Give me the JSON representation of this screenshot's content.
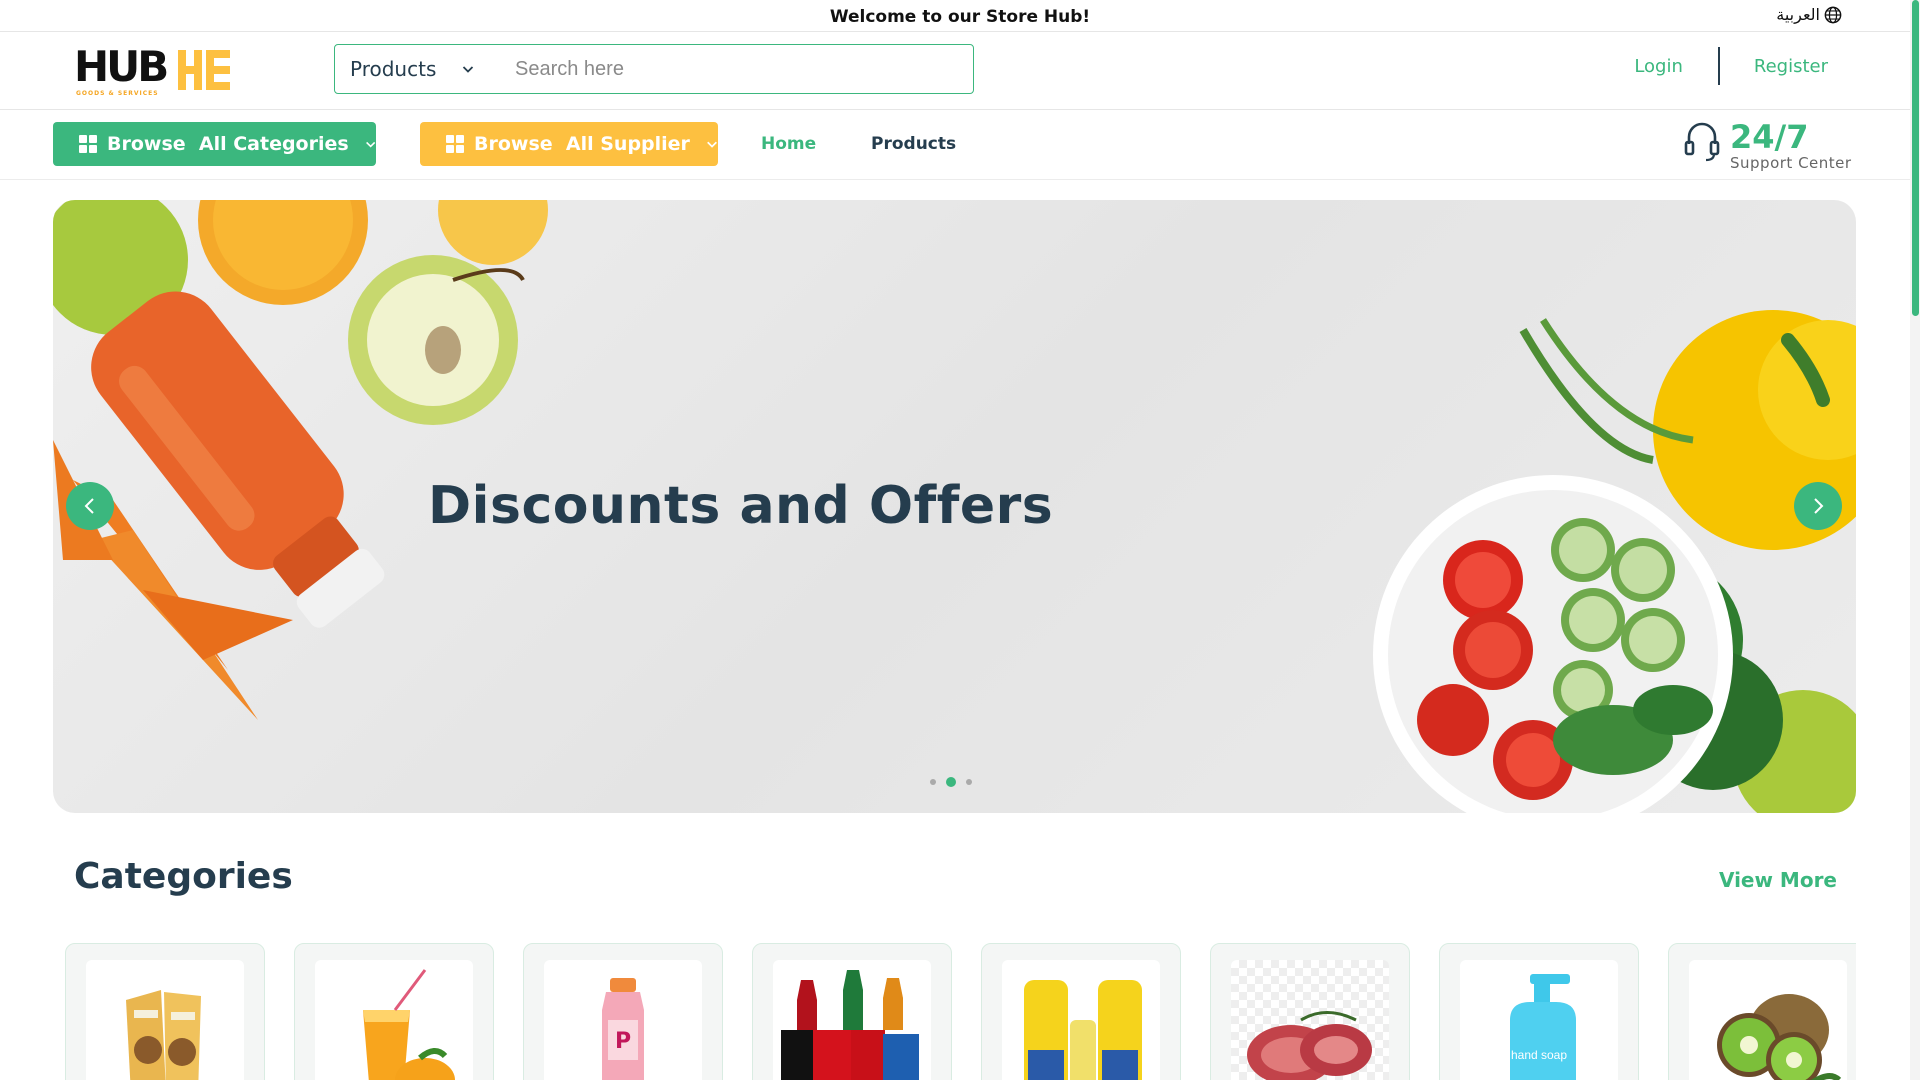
{
  "topbar": {
    "welcome": "Welcome to our Store Hub!",
    "language": "العربية",
    "language_icon": "globe-icon"
  },
  "header": {
    "logo": {
      "text": "HUB",
      "subtext": "GOODS & SERVICES"
    },
    "search": {
      "category_selected": "Products",
      "placeholder": "Search here"
    },
    "auth": {
      "login": "Login",
      "register": "Register"
    }
  },
  "nav": {
    "browse_categories": "Browse  All Categories",
    "browse_suppliers": "Browse  All Supplier",
    "links": {
      "home": "Home",
      "products": "Products"
    },
    "support": {
      "number": "24/7",
      "label": "Support Center",
      "icon": "headset-icon"
    }
  },
  "hero": {
    "headline": "Discounts and Offers",
    "slides_total": 3,
    "active_slide": 2
  },
  "categories": {
    "title": "Categories",
    "view_more": "View More",
    "items": [
      {
        "icon": "snack-bag-icon"
      },
      {
        "icon": "orange-juice-icon"
      },
      {
        "icon": "smoothie-bottle-icon"
      },
      {
        "icon": "soft-drinks-icon"
      },
      {
        "icon": "cooking-oil-icon"
      },
      {
        "icon": "meat-icon"
      },
      {
        "icon": "hand-soap-icon",
        "label": "hand soap"
      },
      {
        "icon": "kiwi-icon"
      }
    ]
  },
  "colors": {
    "brand_green": "#3bb77e",
    "brand_yellow": "#fdc040",
    "text_dark": "#253d4e"
  }
}
